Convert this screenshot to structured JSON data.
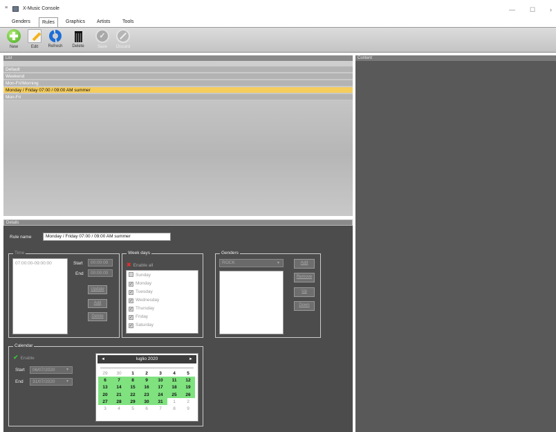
{
  "window": {
    "title": "X-Music Console",
    "minimize": "—",
    "maximize": "☐",
    "close": "›"
  },
  "menu": [
    "Genders",
    "Rules",
    "Graphics",
    "Artists",
    "Tools"
  ],
  "toolbar": {
    "new": "New",
    "edit": "Edit",
    "refresh": "Refresh",
    "delete": "Delete",
    "save": "Save",
    "discard": "Discard"
  },
  "list": {
    "header": "List",
    "rows": [
      "Default",
      "Weekend",
      "Mon-Fri/Morning",
      "Monday / Friday 07:00 / 09:00 AM summer",
      "Mon-Fri"
    ],
    "selected_index": 3
  },
  "content": {
    "header": "Content"
  },
  "details": {
    "header": "Details",
    "rule_name_label": "Rule name",
    "rule_name_value": "Monday / Friday 07:00 / 09:00 AM summer",
    "time": {
      "title": "Time",
      "items": [
        "07:00:00-09:00:00"
      ],
      "start_label": "Start",
      "start_value": "00:00:00",
      "end_label": "End",
      "end_value": "00:00:00",
      "update": "Update",
      "add": "Add",
      "delete": "Delete"
    },
    "weekdays": {
      "title": "Week days",
      "enable_all": "Enable all",
      "days": [
        {
          "label": "Sunday",
          "checked": false
        },
        {
          "label": "Monday",
          "checked": true
        },
        {
          "label": "Tuesday",
          "checked": true
        },
        {
          "label": "Wednesday",
          "checked": true
        },
        {
          "label": "Thursday",
          "checked": true
        },
        {
          "label": "Friday",
          "checked": true
        },
        {
          "label": "Saturday",
          "checked": true
        }
      ]
    },
    "genders": {
      "title": "Genders",
      "select_value": "ROCK",
      "add": "Add",
      "remove": "Remove",
      "up": "Up",
      "down": "Down"
    },
    "calendar": {
      "title": "Calendar",
      "enable": "Enable",
      "start_label": "Start",
      "start_value": "06/07/2020",
      "end_label": "End",
      "end_value": "31/07/2020",
      "month": "luglio 2020",
      "prev": "◄",
      "next": "►",
      "weeks": [
        [
          "29",
          "30",
          "1",
          "2",
          "3",
          "4",
          "5"
        ],
        [
          "6",
          "7",
          "8",
          "9",
          "10",
          "11",
          "12"
        ],
        [
          "13",
          "14",
          "15",
          "16",
          "17",
          "18",
          "19"
        ],
        [
          "20",
          "21",
          "22",
          "23",
          "24",
          "25",
          "26"
        ],
        [
          "27",
          "28",
          "29",
          "30",
          "31",
          "1",
          "2"
        ],
        [
          "3",
          "4",
          "5",
          "6",
          "7",
          "8",
          "9"
        ]
      ]
    }
  },
  "colors": {
    "selected_row": "#f6cd5c",
    "calendar_highlight": "#7fe27f",
    "panel_dark": "#4c4c4c"
  }
}
